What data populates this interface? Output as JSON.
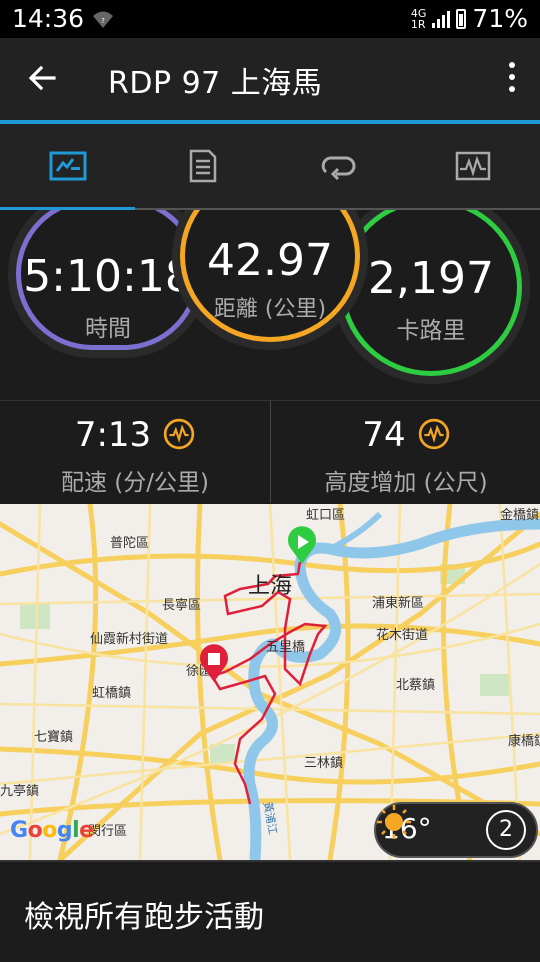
{
  "status_bar": {
    "time": "14:36",
    "network": "4G",
    "network_sub": "1R",
    "battery": "71%"
  },
  "app_bar": {
    "title": "RDP 97 上海馬",
    "back_icon": "arrow-left-icon",
    "menu_icon": "more-vertical-icon"
  },
  "tabs": [
    {
      "icon": "activity-summary-icon",
      "selected": true
    },
    {
      "icon": "details-list-icon",
      "selected": false
    },
    {
      "icon": "laps-loop-icon",
      "selected": false
    },
    {
      "icon": "chart-graph-icon",
      "selected": false
    }
  ],
  "stats": {
    "time": {
      "value": "5:10:18",
      "label": "時間",
      "color": "#7b6fd0"
    },
    "distance": {
      "value": "42.97",
      "label": "距離 (公里)",
      "color": "#f5a623"
    },
    "calories": {
      "value": "2,197",
      "label": "卡路里",
      "color": "#2ecc40"
    }
  },
  "secondary_stats": {
    "pace": {
      "value": "7:13",
      "label": "配速 (分/公里)"
    },
    "elevation": {
      "value": "74",
      "label": "高度增加 (公尺)"
    }
  },
  "map": {
    "places": {
      "hongkou": "虹口區",
      "putuo": "普陀區",
      "shanghai": "上海",
      "changning": "長寧區",
      "pudong": "浦東新區",
      "xianxia": "仙霞新村街道",
      "huamu": "花木街道",
      "wuliqiao": "五里橋",
      "xu": "徐匯",
      "hongqiao": "虹橋鎮",
      "beicai": "北蔡鎮",
      "qibao": "七寶鎮",
      "kangqiao": "康橋鎮",
      "sanlin": "三林鎮",
      "jiupu": "九亭鎮",
      "minhang": "閔行區",
      "jinqiao": "金橋鎮",
      "huangpu": "黃浦江"
    },
    "google_logo": "Google",
    "weather_temp": "16°",
    "weather_icon": "sun-icon",
    "zoom_number": "2"
  },
  "bottom": {
    "link_label": "檢視所有跑步活動"
  }
}
